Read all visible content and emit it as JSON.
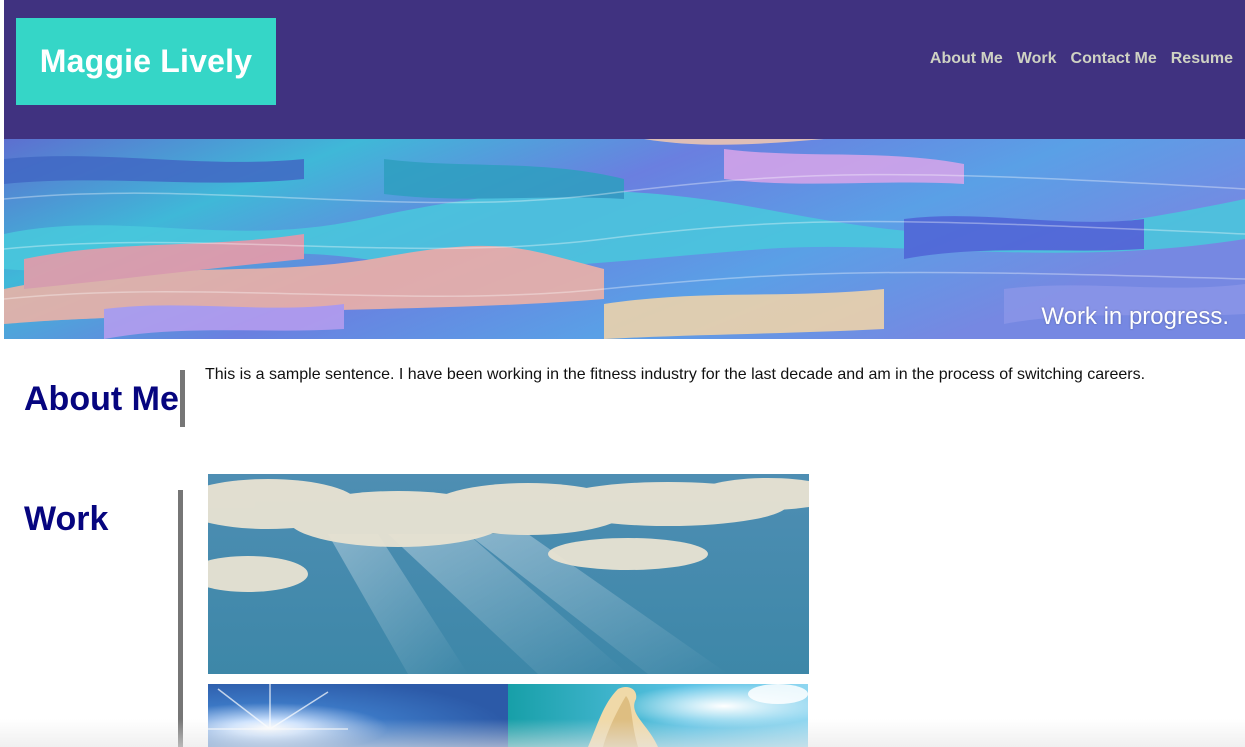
{
  "brand": {
    "name": "Maggie Lively"
  },
  "nav": {
    "items": [
      {
        "label": "About Me"
      },
      {
        "label": "Work"
      },
      {
        "label": "Contact Me"
      },
      {
        "label": "Resume"
      }
    ]
  },
  "hero": {
    "caption": "Work in progress."
  },
  "about": {
    "title": "About Me",
    "text": "This is a sample sentence. I have been working in the fitness industry for the last decade and am in the process of switching careers."
  },
  "work": {
    "title": "Work"
  },
  "colors": {
    "header_bg": "#403280",
    "brand_bg": "#35d6c7",
    "heading": "#06057f",
    "nav_text": "#cfd2c3",
    "divider": "#767676"
  }
}
